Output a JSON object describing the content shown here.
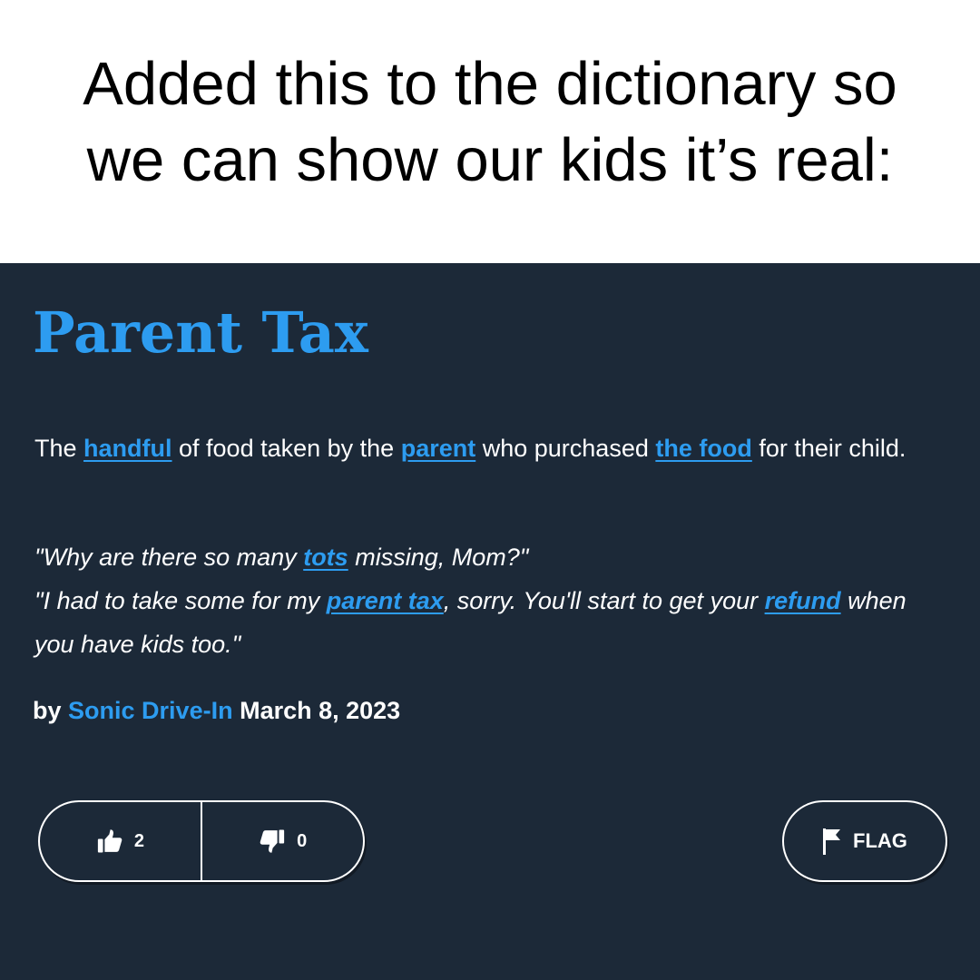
{
  "caption": {
    "line1": "Added this to the dictionary so",
    "line2": "we can show our kids it’s real:"
  },
  "entry": {
    "word": "Parent Tax",
    "meaning": {
      "t1": "The ",
      "link1": "handful",
      "t2": " of food taken by the ",
      "link2": "parent",
      "t3": " who purchased ",
      "link3": "the food",
      "t4": " for their child."
    },
    "example": {
      "t1": "\"Why are there so many ",
      "link1": "tots",
      "t2": " missing, Mom?\"",
      "t3": "\"I had to take some for my ",
      "link2": "parent tax",
      "t4": ", sorry. You'll start to get your ",
      "link3": "refund",
      "t5": " when you have kids too.\""
    },
    "byline": {
      "by": "by",
      "author": "Sonic Drive-In",
      "date": "March 8, 2023"
    }
  },
  "votes": {
    "up_count": "2",
    "down_count": "0",
    "up_icon": "thumbs-up-icon",
    "down_icon": "thumbs-down-icon"
  },
  "flag": {
    "label": "FLAG",
    "icon": "flag-icon"
  },
  "colors": {
    "card_background": "#1c2938",
    "accent": "#2d9cf0",
    "text": "#ffffff"
  }
}
